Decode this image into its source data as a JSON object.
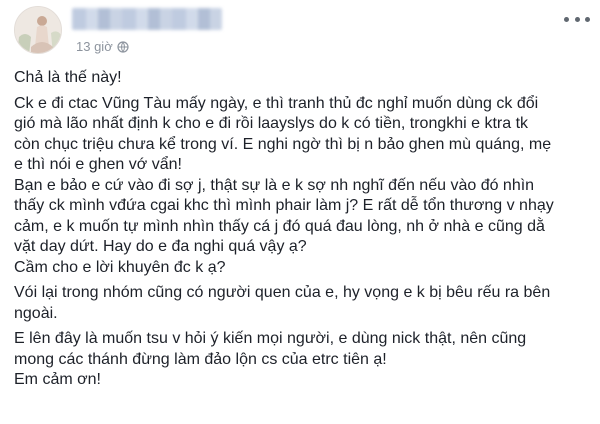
{
  "post": {
    "time": "13 giờ",
    "lines": [
      "Chả là thế này!",
      "",
      "Ck e đi ctac Vũng Tàu mấy ngày, e thì tranh thủ đc nghỉ muốn dùng ck đổi",
      "gió mà lão nhất định k cho e đi rồi laayslys do k có tiền, trongkhi e ktra tk",
      "còn chục triệu chưa kể trong ví. E nghi ngờ thì bị n bảo ghen mù quáng, mẹ",
      "e thì nói e ghen vớ vẩn!",
      "Bạn e bảo e cứ vào đi sợ j, thật sự là e k sợ nh nghĩ đến nếu vào đó nhìn",
      "thấy ck mình vđứa cgai khc thì mình phair làm j? E rất dễ tổn thương v nhạy",
      "cảm, e k muốn tự mình nhìn thấy cá j đó quá đau lòng, nh ở nhà e cũng dằ",
      "vặt day dứt. Hay do e đa nghi quá vậy ạ?",
      "Cầm cho e lời khuyên đc k ạ?",
      "",
      "Vói lại trong nhóm cũng có người quen của e, hy vọng e k bị bêu rếu ra bên",
      "ngoài.",
      "",
      "E lên đây là muốn tsu v hỏi ý kiến mọi người, e dùng nick thật, nên cũng",
      "mong các thánh đừng làm đảo lộn cs của etrc tiên ạ!",
      "Em cảm ơn!"
    ]
  }
}
